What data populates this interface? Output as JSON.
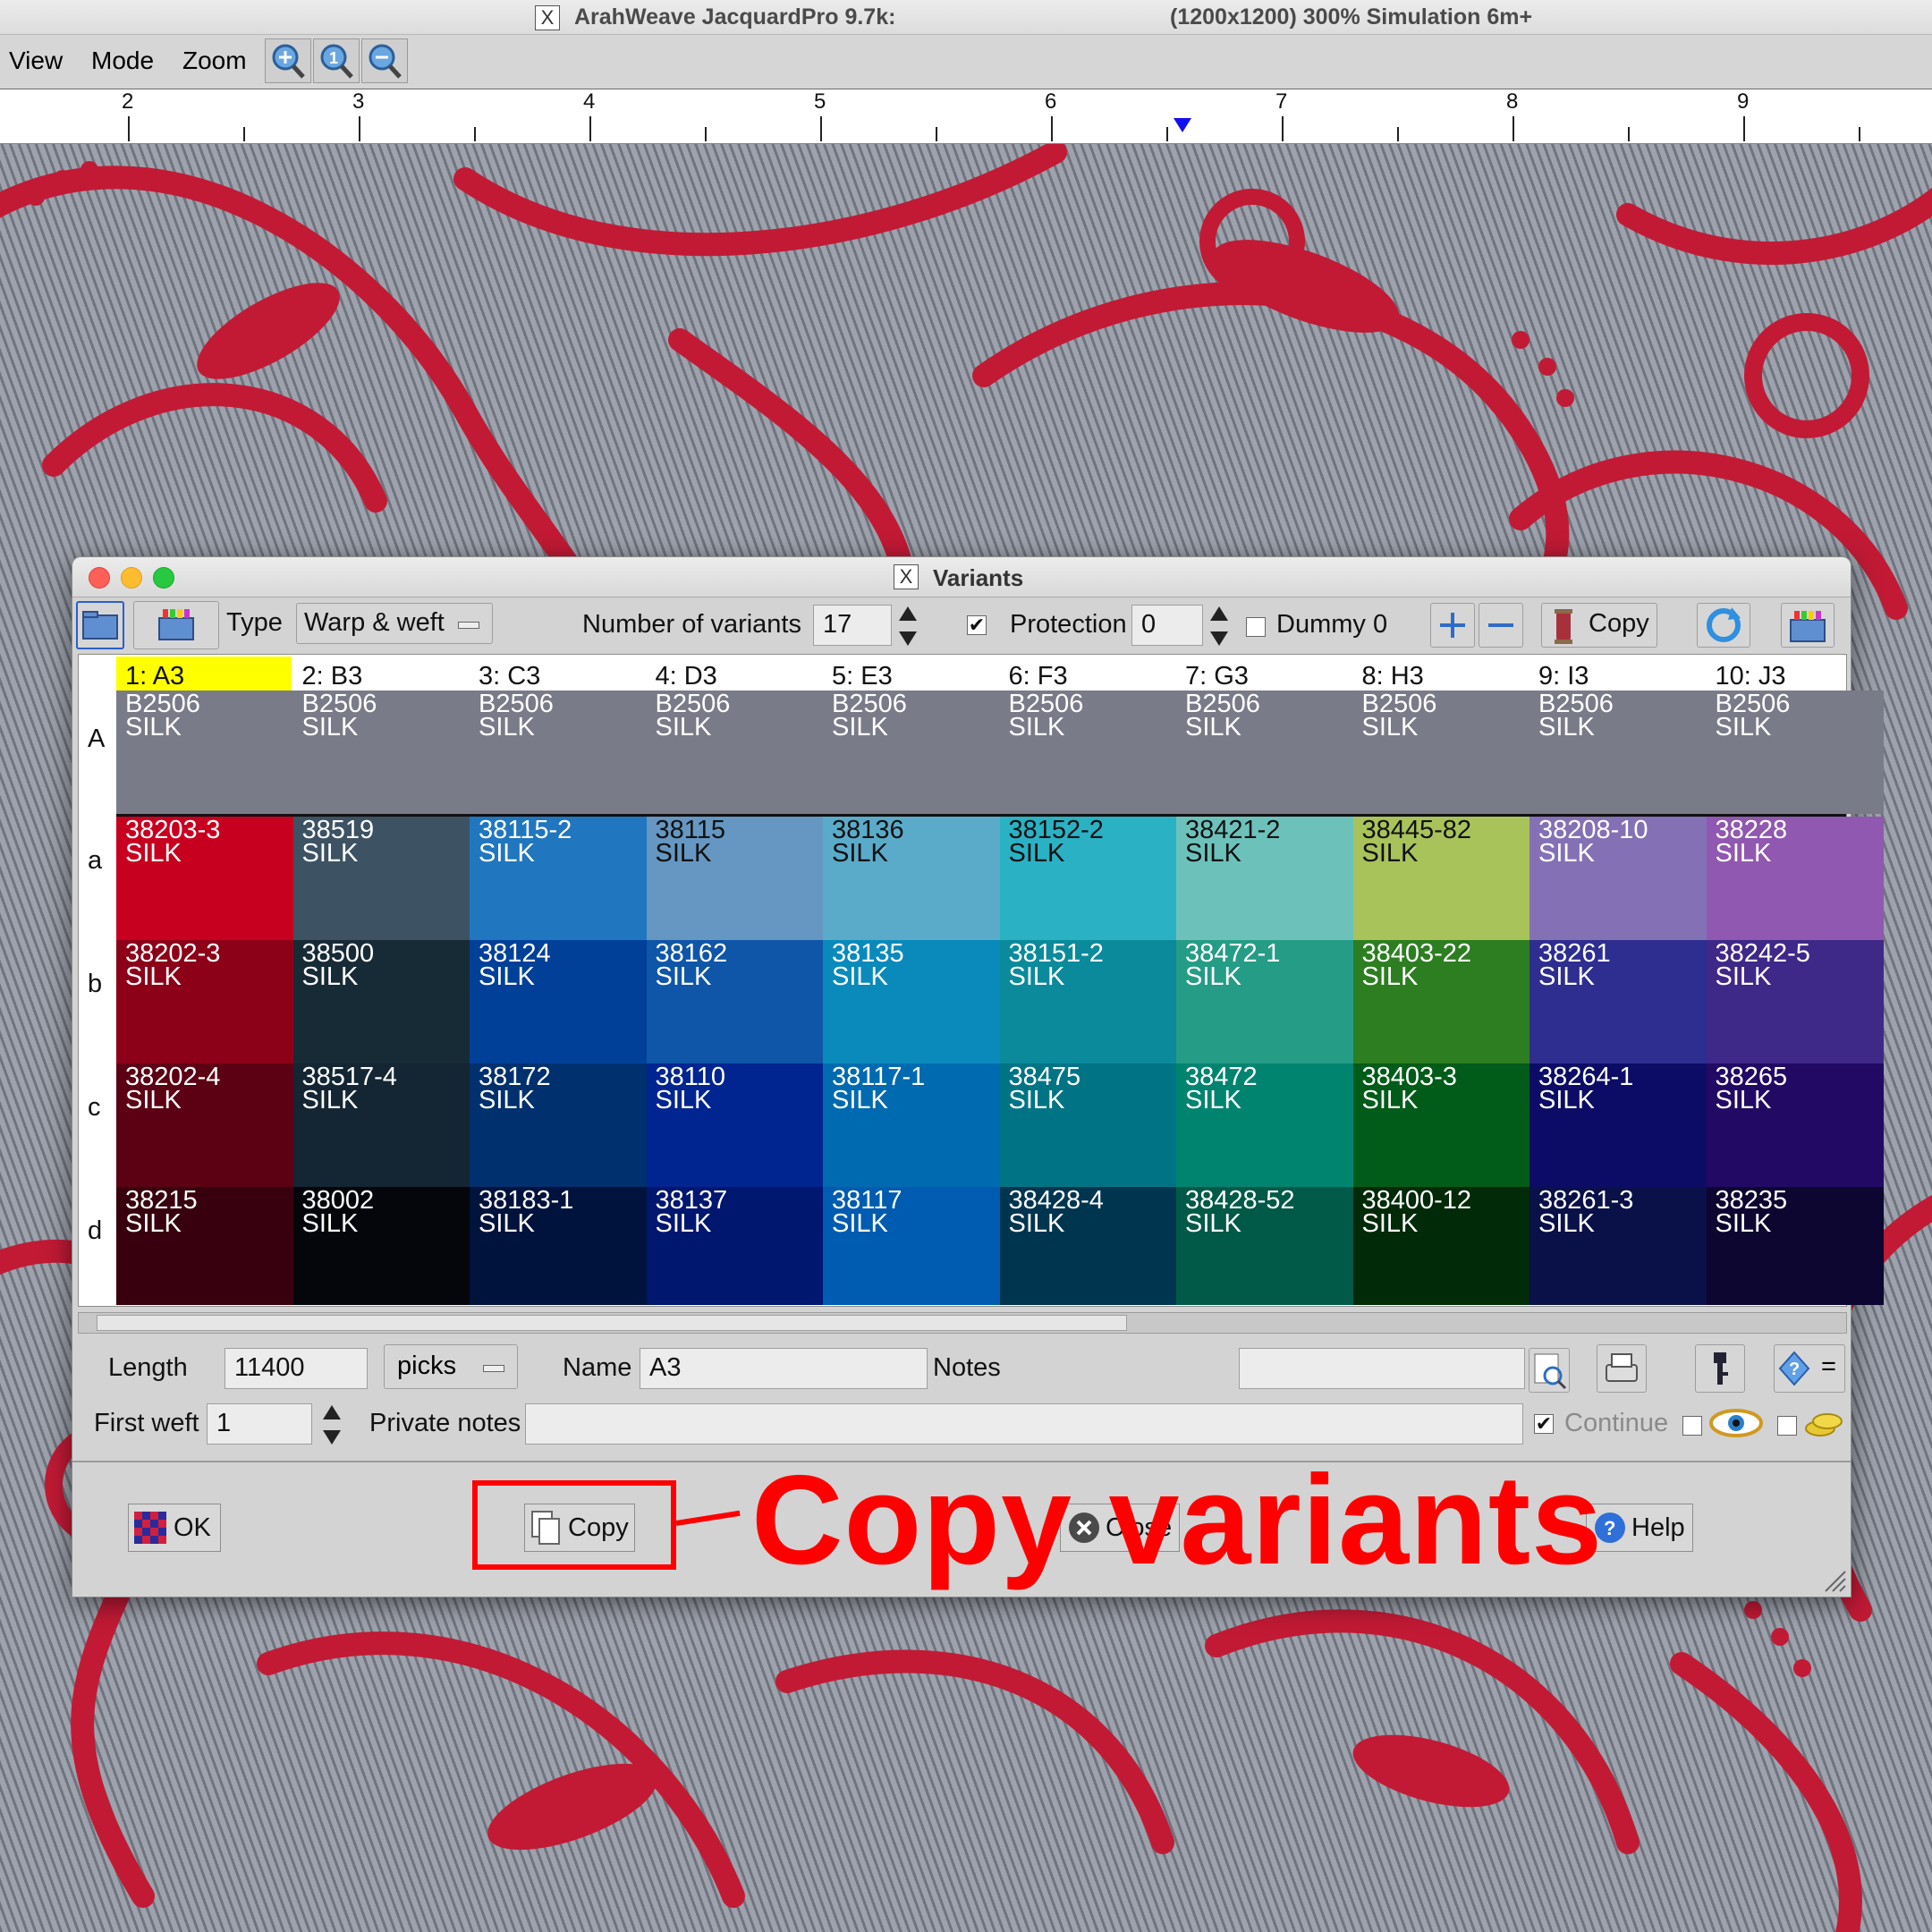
{
  "window": {
    "title_app": "ArahWeave JacquardPro 9.7k:",
    "title_info": "(1200x1200) 300% Simulation 6m+"
  },
  "menu": [
    "View",
    "Mode",
    "Zoom"
  ],
  "ruler": {
    "labels": [
      "2",
      "3",
      "4",
      "5",
      "6",
      "7",
      "8",
      "9"
    ]
  },
  "dialog": {
    "title": "Variants",
    "toolbar": {
      "type_label": "Type",
      "type_value": "Warp & weft",
      "num_variants_label": "Number of variants",
      "num_variants_value": "17",
      "protection_label": "Protection",
      "protection_value": "0",
      "dummy_label": "Dummy 0",
      "copy_label": "Copy"
    },
    "columns": [
      "1: A3",
      "2: B3",
      "3: C3",
      "4: D3",
      "5: E3",
      "6: F3",
      "7: G3",
      "8: H3",
      "9: I3",
      "10: J3"
    ],
    "rows": [
      {
        "label": "A",
        "cells": [
          {
            "code": "B2506",
            "mat": "SILK"
          },
          {
            "code": "B2506",
            "mat": "SILK"
          },
          {
            "code": "B2506",
            "mat": "SILK"
          },
          {
            "code": "B2506",
            "mat": "SILK"
          },
          {
            "code": "B2506",
            "mat": "SILK"
          },
          {
            "code": "B2506",
            "mat": "SILK"
          },
          {
            "code": "B2506",
            "mat": "SILK"
          },
          {
            "code": "B2506",
            "mat": "SILK"
          },
          {
            "code": "B2506",
            "mat": "SILK"
          },
          {
            "code": "B2506",
            "mat": "SILK"
          }
        ],
        "colors": [
          "#7a7b88",
          "#7a7b88",
          "#7a7b88",
          "#7a7b88",
          "#7a7b88",
          "#7a7b88",
          "#7a7b88",
          "#7a7b88",
          "#7a7b88",
          "#7a7b88"
        ],
        "text_colors": [
          "#ffffff",
          "#ffffff",
          "#ffffff",
          "#ffffff",
          "#ffffff",
          "#ffffff",
          "#ffffff",
          "#ffffff",
          "#ffffff",
          "#ffffff"
        ]
      },
      {
        "label": "a",
        "cells": [
          {
            "code": "38203-3",
            "mat": "SILK"
          },
          {
            "code": "38519",
            "mat": "SILK"
          },
          {
            "code": "38115-2",
            "mat": "SILK"
          },
          {
            "code": "38115",
            "mat": "SILK"
          },
          {
            "code": "38136",
            "mat": "SILK"
          },
          {
            "code": "38152-2",
            "mat": "SILK"
          },
          {
            "code": "38421-2",
            "mat": "SILK"
          },
          {
            "code": "38445-82",
            "mat": "SILK"
          },
          {
            "code": "38208-10",
            "mat": "SILK"
          },
          {
            "code": "38228",
            "mat": "SILK"
          }
        ],
        "colors": [
          "#c8001f",
          "#3d5263",
          "#2076bf",
          "#6597c2",
          "#5aabc9",
          "#2ab1c4",
          "#6cc2bb",
          "#a8c35a",
          "#8471b5",
          "#9058b0"
        ],
        "text_colors": [
          "#ffffff",
          "#ffffff",
          "#ffffff",
          "#111111",
          "#111111",
          "#111111",
          "#111111",
          "#111111",
          "#ffffff",
          "#ffffff"
        ]
      },
      {
        "label": "b",
        "cells": [
          {
            "code": "38202-3",
            "mat": "SILK"
          },
          {
            "code": "38500",
            "mat": "SILK"
          },
          {
            "code": "38124",
            "mat": "SILK"
          },
          {
            "code": "38162",
            "mat": "SILK"
          },
          {
            "code": "38135",
            "mat": "SILK"
          },
          {
            "code": "38151-2",
            "mat": "SILK"
          },
          {
            "code": "38472-1",
            "mat": "SILK"
          },
          {
            "code": "38403-22",
            "mat": "SILK"
          },
          {
            "code": "38261",
            "mat": "SILK"
          },
          {
            "code": "38242-5",
            "mat": "SILK"
          }
        ],
        "colors": [
          "#8c0018",
          "#172b37",
          "#004099",
          "#0f56a8",
          "#0a8abb",
          "#0b8a9b",
          "#259c86",
          "#2d7e21",
          "#2e2d90",
          "#3e2888"
        ],
        "text_colors": [
          "#ffffff",
          "#ffffff",
          "#ffffff",
          "#ffffff",
          "#ffffff",
          "#ffffff",
          "#ffffff",
          "#ffffff",
          "#ffffff",
          "#ffffff"
        ]
      },
      {
        "label": "c",
        "cells": [
          {
            "code": "38202-4",
            "mat": "SILK"
          },
          {
            "code": "38517-4",
            "mat": "SILK"
          },
          {
            "code": "38172",
            "mat": "SILK"
          },
          {
            "code": "38110",
            "mat": "SILK"
          },
          {
            "code": "38117-1",
            "mat": "SILK"
          },
          {
            "code": "38475",
            "mat": "SILK"
          },
          {
            "code": "38472",
            "mat": "SILK"
          },
          {
            "code": "38403-3",
            "mat": "SILK"
          },
          {
            "code": "38264-1",
            "mat": "SILK"
          },
          {
            "code": "38265",
            "mat": "SILK"
          }
        ],
        "colors": [
          "#5c0014",
          "#142633",
          "#00306e",
          "#002590",
          "#006ab0",
          "#007485",
          "#008470",
          "#005c18",
          "#0c0c66",
          "#220a64"
        ],
        "text_colors": [
          "#ffffff",
          "#ffffff",
          "#ffffff",
          "#ffffff",
          "#ffffff",
          "#ffffff",
          "#ffffff",
          "#ffffff",
          "#ffffff",
          "#ffffff"
        ]
      },
      {
        "label": "d",
        "cells": [
          {
            "code": "38215",
            "mat": "SILK"
          },
          {
            "code": "38002",
            "mat": "SILK"
          },
          {
            "code": "38183-1",
            "mat": "SILK"
          },
          {
            "code": "38137",
            "mat": "SILK"
          },
          {
            "code": "38117",
            "mat": "SILK"
          },
          {
            "code": "38428-4",
            "mat": "SILK"
          },
          {
            "code": "38428-52",
            "mat": "SILK"
          },
          {
            "code": "38400-12",
            "mat": "SILK"
          },
          {
            "code": "38261-3",
            "mat": "SILK"
          },
          {
            "code": "38235",
            "mat": "SILK"
          }
        ],
        "colors": [
          "#38000e",
          "#05060b",
          "#00133d",
          "#001770",
          "#005cb0",
          "#003550",
          "#005a47",
          "#002a08",
          "#0a1048",
          "#0c0630"
        ],
        "text_colors": [
          "#ffffff",
          "#ffffff",
          "#ffffff",
          "#ffffff",
          "#ffffff",
          "#ffffff",
          "#ffffff",
          "#ffffff",
          "#ffffff",
          "#ffffff"
        ]
      }
    ],
    "selected_column_color": "#ffff00",
    "bottom": {
      "length_label": "Length",
      "length_value": "11400",
      "unit_value": "picks",
      "name_label": "Name",
      "name_value": "A3",
      "notes_label": "Notes",
      "notes_value": "",
      "first_weft_label": "First weft",
      "first_weft_value": "1",
      "private_notes_label": "Private notes",
      "private_notes_value": "",
      "continue_label": "Continue",
      "equals_label": "=",
      "ok_label": "OK",
      "copy_label": "Copy",
      "close_label": "Close",
      "help_label": "Help"
    }
  },
  "annotation": {
    "text": "Copy variants",
    "color": "#ff0000"
  }
}
